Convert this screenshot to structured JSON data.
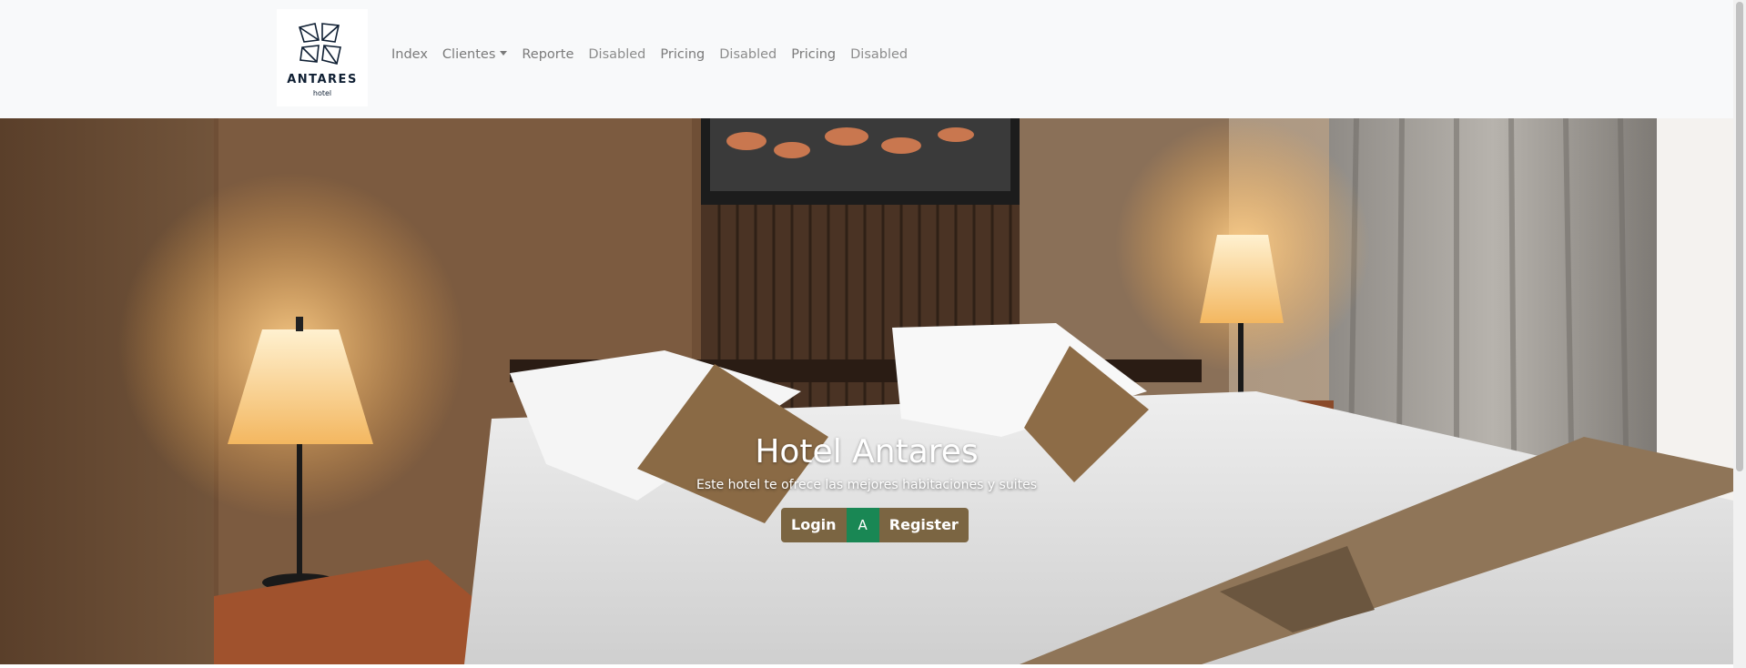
{
  "brand": {
    "name": "ANTARES",
    "sub": "hotel"
  },
  "nav": {
    "items": [
      {
        "label": "Index"
      },
      {
        "label": "Clientes"
      },
      {
        "label": "Reporte"
      },
      {
        "label": "Disabled"
      },
      {
        "label": "Pricing"
      },
      {
        "label": "Disabled"
      },
      {
        "label": "Pricing"
      },
      {
        "label": "Disabled"
      }
    ]
  },
  "hero": {
    "title": "Hotel Antares",
    "text": "Este hotel te ofrece las mejores habitaciones y suites",
    "buttons": {
      "login": "Login",
      "middle": "A",
      "register": "Register"
    }
  },
  "colors": {
    "navbar_bg": "#f8f9fa",
    "button_brown": "#7b6542",
    "button_green": "#198754",
    "brand_dark": "#0f1f33"
  }
}
